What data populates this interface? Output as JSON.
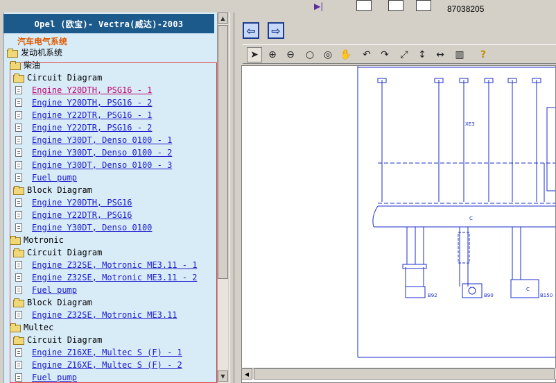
{
  "topbar": {
    "code_text": "87038205"
  },
  "tree": {
    "title": "Opel (欧宝)- Vectra(威达)-2003",
    "subtitle": "汽车电气系统",
    "root": "发动机系统",
    "rows": [
      {
        "kind": "folder",
        "text": "柴油"
      },
      {
        "kind": "folder",
        "text": "Circuit Diagram"
      },
      {
        "kind": "doc",
        "text": "Engine Y20DTH, PSG16 - 1",
        "active": true
      },
      {
        "kind": "doc",
        "text": "Engine Y20DTH, PSG16 - 2"
      },
      {
        "kind": "doc",
        "text": "Engine Y22DTR, PSG16 - 1"
      },
      {
        "kind": "doc",
        "text": "Engine Y22DTR, PSG16 - 2"
      },
      {
        "kind": "doc",
        "text": "Engine Y30DT, Denso 0100 - 1"
      },
      {
        "kind": "doc",
        "text": "Engine Y30DT, Denso 0100 - 2"
      },
      {
        "kind": "doc",
        "text": "Engine Y30DT, Denso 0100 - 3"
      },
      {
        "kind": "doc",
        "text": "Fuel pump"
      },
      {
        "kind": "folder",
        "text": "Block Diagram"
      },
      {
        "kind": "doc",
        "text": "Engine Y20DTH, PSG16"
      },
      {
        "kind": "doc",
        "text": "Engine Y22DTR, PSG16"
      },
      {
        "kind": "doc",
        "text": "Engine Y30DT, Denso 0100"
      },
      {
        "kind": "folder",
        "text": "Motronic"
      },
      {
        "kind": "folder",
        "text": "Circuit Diagram"
      },
      {
        "kind": "doc",
        "text": "Engine Z32SE, Motronic ME3.11 - 1"
      },
      {
        "kind": "doc",
        "text": "Engine Z32SE, Motronic ME3.11 - 2"
      },
      {
        "kind": "doc",
        "text": "Fuel pump"
      },
      {
        "kind": "folder",
        "text": "Block Diagram"
      },
      {
        "kind": "doc",
        "text": "Engine Z32SE, Motronic ME3.11"
      },
      {
        "kind": "folder",
        "text": "Multec"
      },
      {
        "kind": "folder",
        "text": "Circuit Diagram"
      },
      {
        "kind": "doc",
        "text": "Engine Z16XE, Multec S (F) - 1"
      },
      {
        "kind": "doc",
        "text": "Engine Z16XE, Multec S (F) - 2"
      },
      {
        "kind": "doc",
        "text": "Fuel pump"
      }
    ]
  },
  "viewer": {
    "nav": {
      "back_icon": "arrow-left-icon",
      "forward_icon": "arrow-right-icon"
    },
    "tools": [
      "pointer-icon",
      "zoom-in-icon",
      "zoom-out-icon",
      "zoom-icon",
      "zoom-area-icon",
      "pan-hand-icon",
      "rotate-left-icon",
      "rotate-right-icon",
      "fit-page-icon",
      "fit-height-icon",
      "fit-width-icon",
      "contrast-icon",
      "help-icon"
    ],
    "diagram": {
      "labels": {
        "connector_xe3": "XE3",
        "component_c": "C",
        "b92": "B92",
        "b90": "B90",
        "b150": "B150"
      },
      "color": "#1a2cc8"
    }
  }
}
